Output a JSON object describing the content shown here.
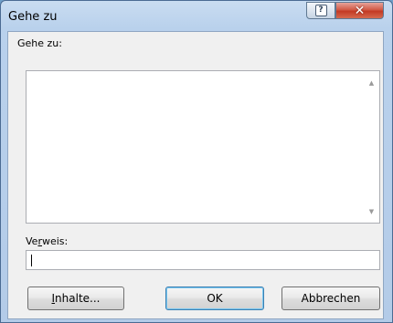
{
  "window": {
    "title": "Gehe zu"
  },
  "titlebar": {
    "help_label": "?",
    "close_label": "✕"
  },
  "goto": {
    "label": "Gehe zu:"
  },
  "reference": {
    "label_prefix": "Ve",
    "label_mnemonic": "r",
    "label_suffix": "weis:",
    "value": ""
  },
  "buttons": {
    "contents_mnemonic": "I",
    "contents_rest": "nhalte...",
    "ok_label": "OK",
    "cancel_label": "Abbrechen"
  },
  "scroll": {
    "up": "▲",
    "down": "▼"
  }
}
